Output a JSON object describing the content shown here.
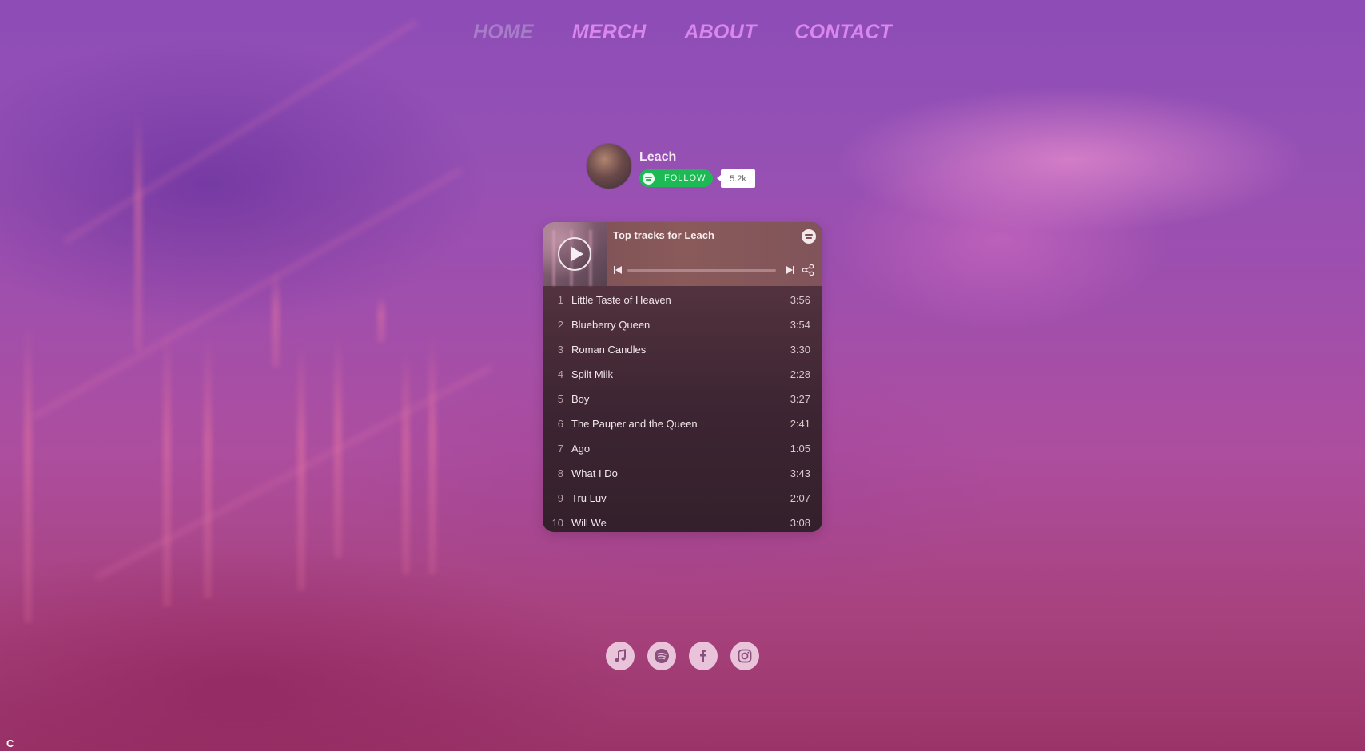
{
  "nav": {
    "items": [
      {
        "label": "HOME",
        "active": true
      },
      {
        "label": "MERCH",
        "active": false
      },
      {
        "label": "ABOUT",
        "active": false
      },
      {
        "label": "CONTACT",
        "active": false
      }
    ]
  },
  "artist": {
    "name": "Leach",
    "follow_label": "FOLLOW",
    "followers": "5.2k"
  },
  "player": {
    "title": "Top tracks for Leach",
    "progress": 0,
    "tracks": [
      {
        "num": "1",
        "title": "Little Taste of Heaven",
        "duration": "3:56"
      },
      {
        "num": "2",
        "title": "Blueberry Queen",
        "duration": "3:54"
      },
      {
        "num": "3",
        "title": "Roman Candles",
        "duration": "3:30"
      },
      {
        "num": "4",
        "title": "Spilt Milk",
        "duration": "2:28"
      },
      {
        "num": "5",
        "title": "Boy",
        "duration": "3:27"
      },
      {
        "num": "6",
        "title": "The Pauper and the Queen",
        "duration": "2:41"
      },
      {
        "num": "7",
        "title": "Ago",
        "duration": "1:05"
      },
      {
        "num": "8",
        "title": "What I Do",
        "duration": "3:43"
      },
      {
        "num": "9",
        "title": "Tru Luv",
        "duration": "2:07"
      },
      {
        "num": "10",
        "title": "Will We",
        "duration": "3:08"
      }
    ]
  },
  "socials": [
    {
      "icon": "music-note-icon"
    },
    {
      "icon": "spotify-icon"
    },
    {
      "icon": "facebook-icon"
    },
    {
      "icon": "instagram-icon"
    }
  ],
  "colors": {
    "nav_link": "#d987ec",
    "nav_active": "#a77cc8",
    "follow_green": "#1db954",
    "social_circle": "#e8c3da",
    "social_icon": "#8a4f7c"
  }
}
